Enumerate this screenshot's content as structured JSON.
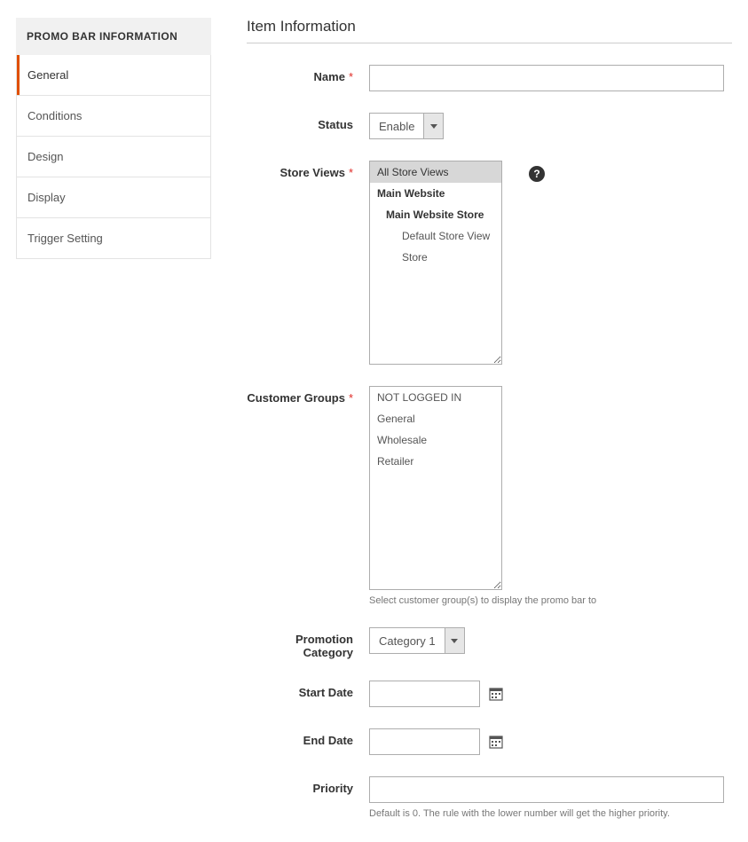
{
  "sidebar": {
    "header": "PROMO BAR INFORMATION",
    "items": [
      {
        "label": "General",
        "active": true
      },
      {
        "label": "Conditions",
        "active": false
      },
      {
        "label": "Design",
        "active": false
      },
      {
        "label": "Display",
        "active": false
      },
      {
        "label": "Trigger Setting",
        "active": false
      }
    ]
  },
  "section_title": "Item Information",
  "fields": {
    "name": {
      "label": "Name",
      "required": true,
      "value": ""
    },
    "status": {
      "label": "Status",
      "value": "Enable"
    },
    "store_views": {
      "label": "Store Views",
      "required": true,
      "options": [
        {
          "label": "All Store Views",
          "selected": true,
          "indent": 0,
          "bold": false
        },
        {
          "label": "Main Website",
          "selected": false,
          "indent": 0,
          "bold": true
        },
        {
          "label": "Main Website Store",
          "selected": false,
          "indent": 1,
          "bold": true
        },
        {
          "label": "Default Store View",
          "selected": false,
          "indent": 2,
          "bold": false
        },
        {
          "label": "Store",
          "selected": false,
          "indent": 2,
          "bold": false
        }
      ]
    },
    "customer_groups": {
      "label": "Customer Groups",
      "required": true,
      "options": [
        {
          "label": "NOT LOGGED IN"
        },
        {
          "label": "General"
        },
        {
          "label": "Wholesale"
        },
        {
          "label": "Retailer"
        }
      ],
      "note": "Select customer group(s) to display the promo bar to"
    },
    "promotion_category": {
      "label": "Promotion Category",
      "value": "Category 1"
    },
    "start_date": {
      "label": "Start Date",
      "value": ""
    },
    "end_date": {
      "label": "End Date",
      "value": ""
    },
    "priority": {
      "label": "Priority",
      "value": "",
      "note": "Default is 0. The rule with the lower number will get the higher priority."
    }
  }
}
